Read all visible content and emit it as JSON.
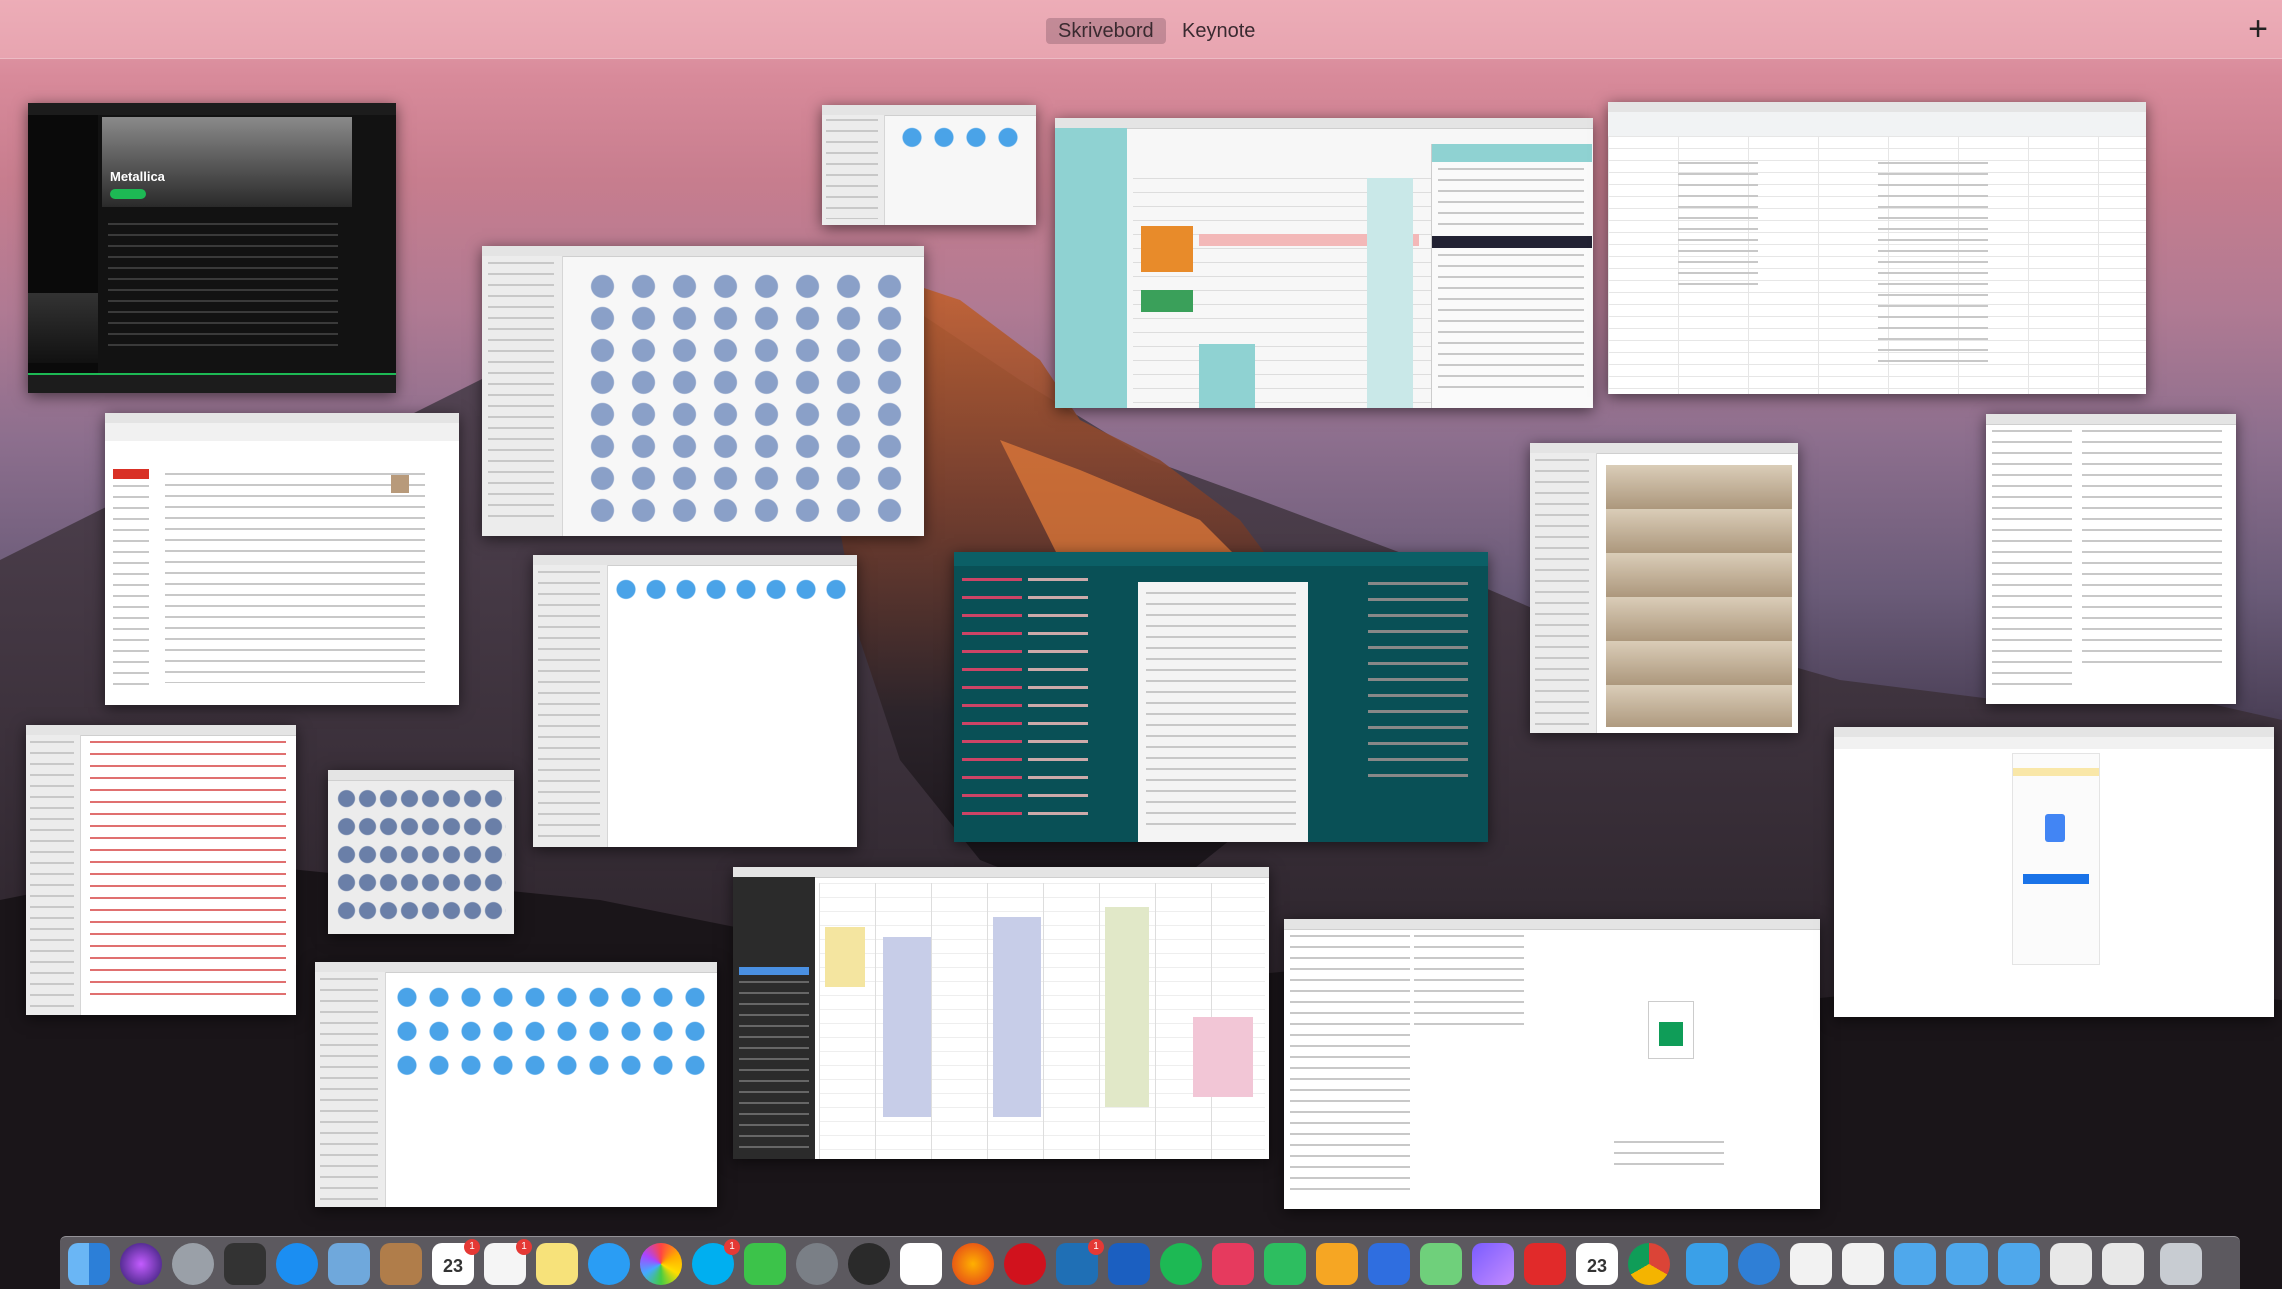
{
  "spaces": {
    "space_1": "Skrivebord",
    "space_2": "Keynote",
    "add": "+"
  },
  "windows": {
    "spotify_artist": "Metallica"
  },
  "dock": {
    "calendar_date_1": "23",
    "calendar_date_2": "23",
    "badge_calendar": "1",
    "badge_reminders": "1",
    "badge_skype": "1",
    "badge_app": "1"
  },
  "colors": {
    "spotify_green": "#1db954",
    "trello_teal": "#0f7b84",
    "calendar_orange": "#e88b2a",
    "sky_pink": "#e8a4b0"
  }
}
